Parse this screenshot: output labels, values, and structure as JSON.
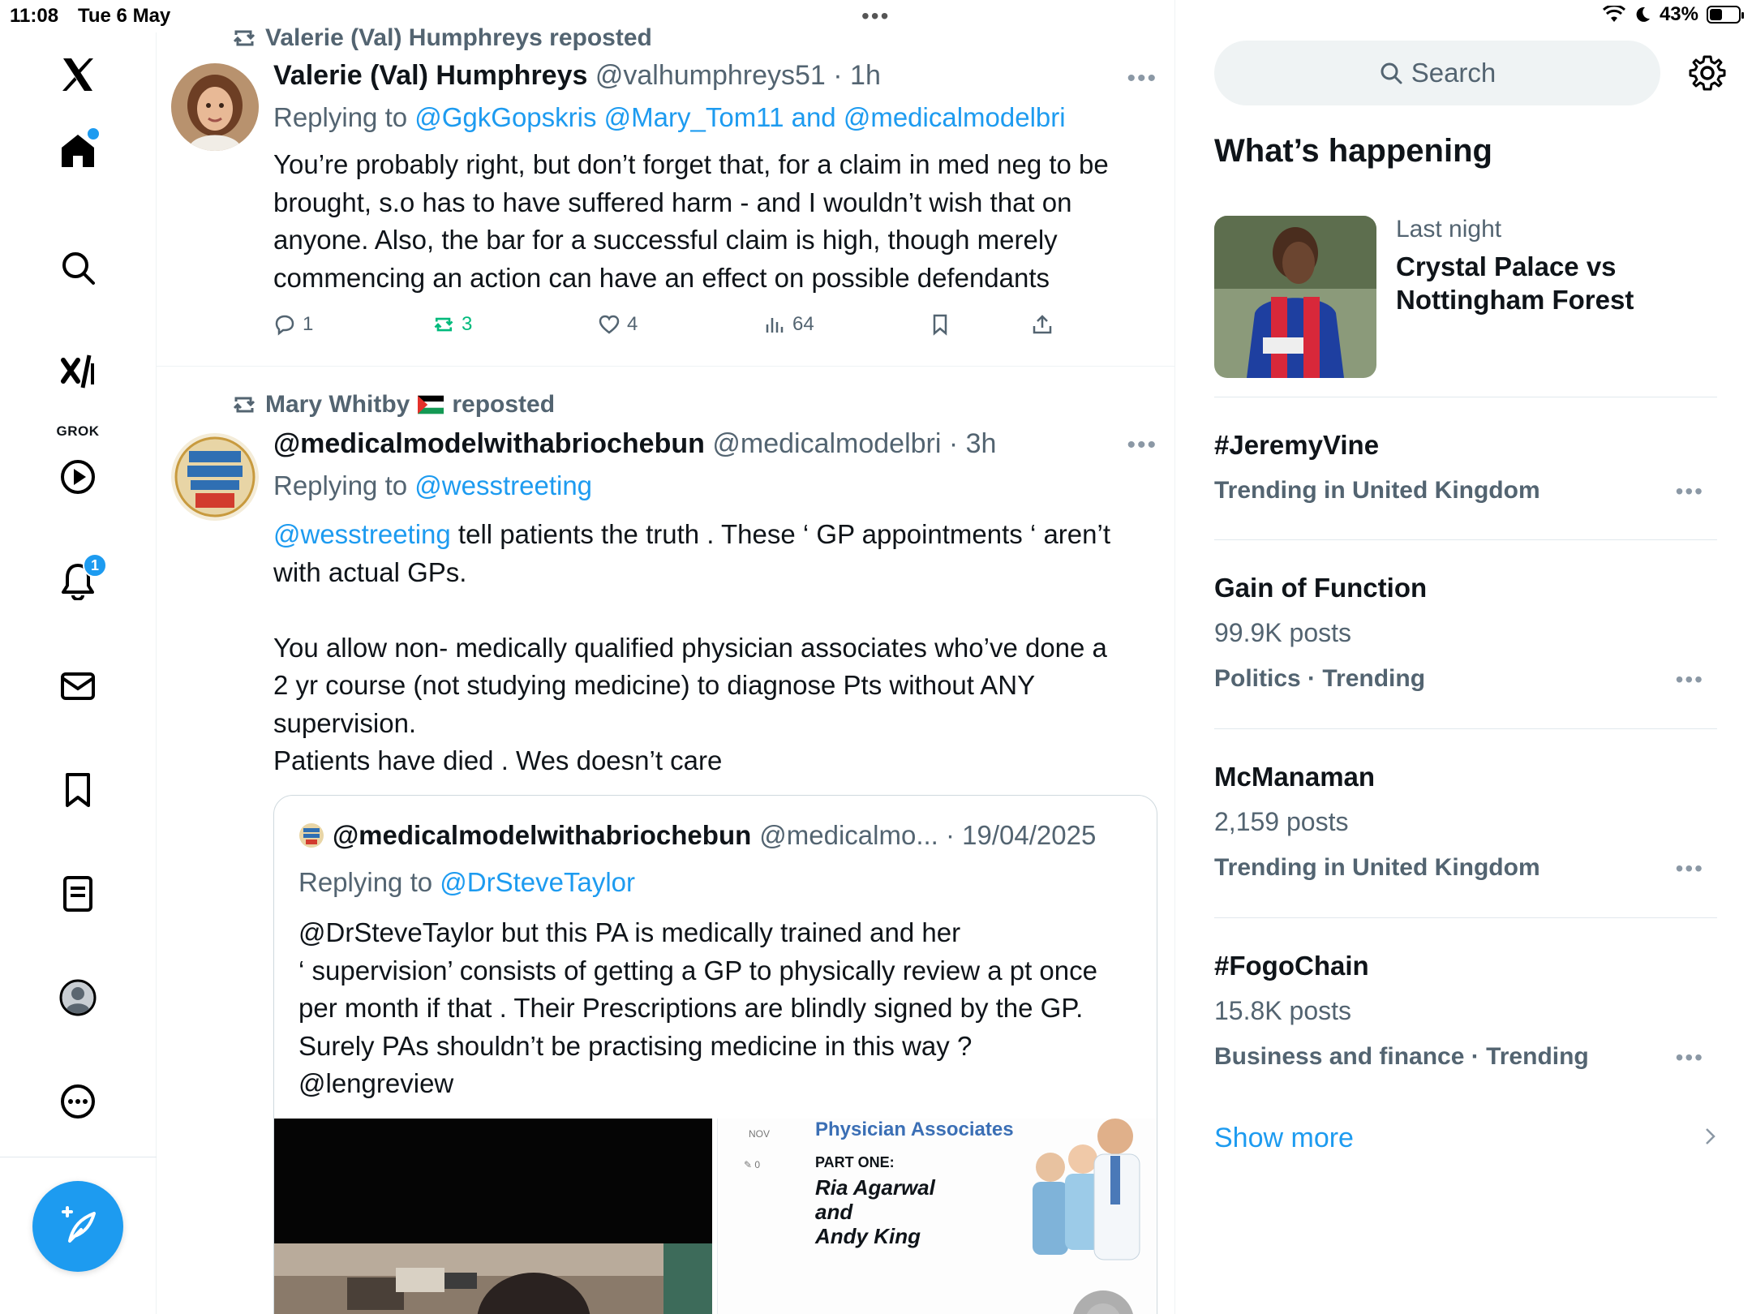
{
  "status_bar": {
    "time": "11:08",
    "date": "Tue 6 May",
    "battery": "43%",
    "battery_level": 0.43
  },
  "nav": {
    "logo": "x-logo-icon",
    "items": [
      {
        "name": "home",
        "icon": "home-icon",
        "has_dot": true
      },
      {
        "name": "explore",
        "icon": "search-icon"
      },
      {
        "name": "grok",
        "icon": "grok-icon",
        "label": "GROK"
      },
      {
        "name": "video",
        "icon": "play-icon"
      },
      {
        "name": "notifications",
        "icon": "bell-icon",
        "badge": "1"
      },
      {
        "name": "messages",
        "icon": "mail-icon"
      },
      {
        "name": "bookmarks",
        "icon": "bookmark-icon"
      },
      {
        "name": "lists",
        "icon": "list-icon"
      },
      {
        "name": "profile",
        "icon": "profile-icon"
      },
      {
        "name": "more",
        "icon": "more-circle-icon"
      }
    ],
    "compose_icon": "compose-icon"
  },
  "timeline": {
    "posts": [
      {
        "reposted_by": "Valerie (Val) Humphreys reposted",
        "name": "Valerie (Val) Humphreys",
        "handle_time": "@valhumphreys51 · 1h",
        "replying_prefix": "Replying to ",
        "replying_to": "@GgkGopskris @Mary_Tom11 and @medicalmodelbri",
        "text_lines": [
          "You’re probably right, but don’t forget that, for a claim in med neg to be",
          "brought, s.o has to have suffered harm - and I wouldn’t wish that on",
          "anyone. Also, the bar for a successful claim is high, though merely",
          "commencing an action can have an effect on possible defendants"
        ],
        "replies": "1",
        "reposts": "3",
        "likes": "4",
        "views": "64"
      },
      {
        "reposted_by_name": "Mary Whitby",
        "reposted_suffix": "reposted",
        "name": "@medicalmodelwithabriochebun",
        "handle_time": "@medicalmodelbri · 3h",
        "replying_prefix": "Replying to ",
        "replying_to": "@wesstreeting",
        "mention": "@wesstreeting",
        "text_line1_rest": " tell patients the truth . These ‘ GP appointments ‘ aren’t",
        "text_lines": [
          "with actual GPs.",
          "",
          "You allow non- medically qualified physician associates who’ve done a",
          "2 yr course (not studying medicine) to diagnose Pts without ANY",
          "supervision.",
          "Patients have died . Wes doesn’t care"
        ],
        "quote": {
          "name": "@medicalmodelwithabriochebun",
          "handle_time": "@medicalmo... · 19/04/2025",
          "replying_prefix": "Replying to ",
          "replying_to": "@DrSteveTaylor",
          "text_lines": [
            "@DrSteveTaylor but this PA is medically trained and her",
            "‘ supervision’ consists of getting a GP to physically review a pt once",
            "per month if that . Their Prescriptions are blindly signed by the GP.",
            "Surely PAs shouldn’t be practising medicine in this way ?",
            "@lengreview"
          ],
          "media_right": {
            "month": "NOV",
            "comments": "0",
            "title": "Physician Associates",
            "part": "PART ONE:",
            "line1": "Ria Agarwal",
            "line2": "and",
            "line3": "Andy King"
          }
        }
      }
    ]
  },
  "right": {
    "search_placeholder": "Search",
    "section_title": "What’s happening",
    "news": {
      "meta": "Last night",
      "headline": "Crystal Palace vs Nottingham Forest"
    },
    "trends": [
      {
        "name": "#JeremyVine",
        "count": "",
        "context": "Trending in United Kingdom"
      },
      {
        "name": "Gain of Function",
        "count": "99.9K posts",
        "context": "Politics · Trending"
      },
      {
        "name": "McManaman",
        "count": "2,159 posts",
        "context": "Trending in United Kingdom"
      },
      {
        "name": "#FogoChain",
        "count": "15.8K posts",
        "context": "Business and finance · Trending"
      }
    ],
    "show_more": "Show more"
  },
  "colors": {
    "accent": "#1d9bf0",
    "repost_green": "#00ba7c",
    "secondary_text": "#536471"
  }
}
